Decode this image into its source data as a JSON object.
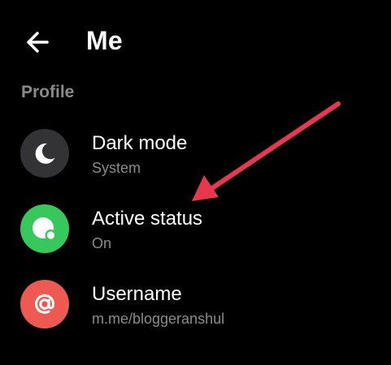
{
  "header": {
    "title": "Me",
    "back_icon": "arrow-left-icon"
  },
  "profile_section": {
    "label": "Profile",
    "items": [
      {
        "title": "Dark mode",
        "subtitle": "System",
        "icon": "moon-icon",
        "icon_bg": "#333336"
      },
      {
        "title": "Active status",
        "subtitle": "On",
        "icon": "active-status-icon",
        "icon_bg": "#36c85a"
      },
      {
        "title": "Username",
        "subtitle": "m.me/bloggeranshul",
        "icon": "at-sign-icon",
        "icon_bg": "#ee5a52"
      }
    ]
  },
  "annotation": {
    "arrow_color": "#e8384f"
  }
}
